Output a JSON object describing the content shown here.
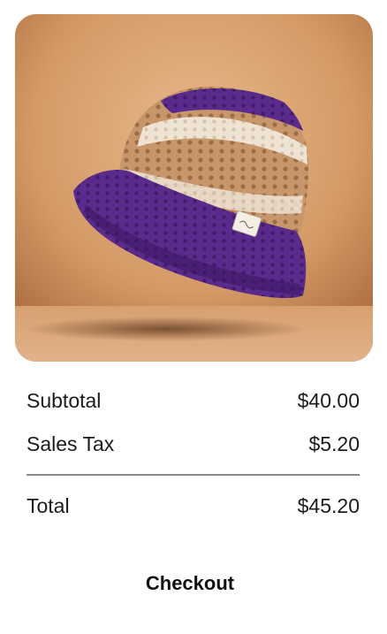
{
  "product": {
    "image_icon": "crochet-bucket-hat-photo",
    "colors": {
      "background": "#d9a574",
      "purple": "#5b2a8e",
      "beige": "#c99a70",
      "cream": "#efe6d8"
    }
  },
  "summary": {
    "subtotal_label": "Subtotal",
    "subtotal_value": "$40.00",
    "tax_label": "Sales Tax",
    "tax_value": "$5.20",
    "total_label": "Total",
    "total_value": "$45.20"
  },
  "actions": {
    "checkout_label": "Checkout"
  }
}
